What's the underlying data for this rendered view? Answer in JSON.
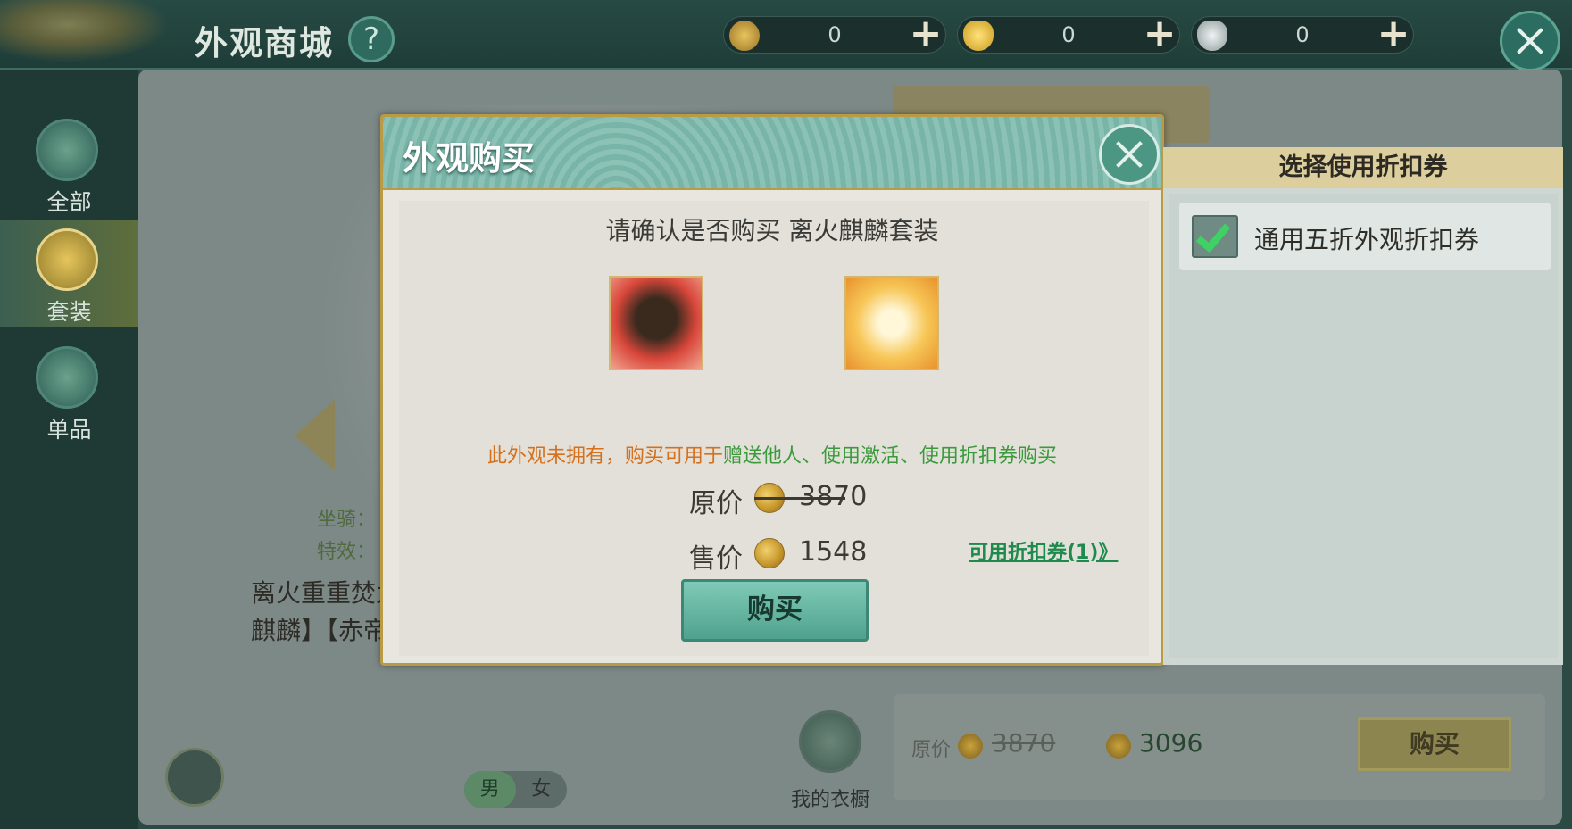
{
  "header": {
    "title": "外观商城",
    "help_icon": "?",
    "currencies": [
      {
        "icon": "copper-coin-icon",
        "value": "0"
      },
      {
        "icon": "gold-ingot-icon",
        "value": "0"
      },
      {
        "icon": "silver-ingot-icon",
        "value": "0"
      }
    ],
    "plus": "+"
  },
  "sidebar": {
    "items": [
      {
        "label": "全部",
        "icon": "pavilion-icon"
      },
      {
        "label": "套装",
        "icon": "robe-icon"
      },
      {
        "label": "单品",
        "icon": "shirt-icon"
      }
    ]
  },
  "background": {
    "mount_label": "坐骑：",
    "effect_label": "特效：",
    "description": "离火重重焚九天。购买后可在背包进行使用，赠送【离火麒麟】【赤帝鎏影】坐骑及特效。",
    "gender": [
      "男",
      "女"
    ],
    "wardrobe_label": "我的衣橱",
    "bottom_orig_label": "原价",
    "bottom_orig_price": "3870",
    "bottom_price": "3096",
    "bottom_buy": "购买"
  },
  "dialog": {
    "title": "外观购买",
    "confirm_text": "请确认是否购买 离火麒麟套装",
    "items": [
      {
        "name": "mount-item",
        "icon": "qilin-head-icon"
      },
      {
        "name": "effect-item",
        "icon": "flame-effect-icon"
      }
    ],
    "notice_orange": "此外观未拥有，购买可用于",
    "notice_green": "赠送他人、使用激活、使用折扣券购买",
    "original_label": "原价",
    "original_price": "3870",
    "sale_label": "售价",
    "sale_price": "1548",
    "voucher_link": "可用折扣券(1)》",
    "buy_button": "购买"
  },
  "voucher_panel": {
    "title": "选择使用折扣券",
    "items": [
      {
        "label": "通用五折外观折扣券",
        "checked": true
      }
    ]
  },
  "colors": {
    "accent_teal": "#4fa28e",
    "gold_border": "#b99a45",
    "notice_orange": "#d6701b",
    "notice_green": "#3a9a3c"
  }
}
